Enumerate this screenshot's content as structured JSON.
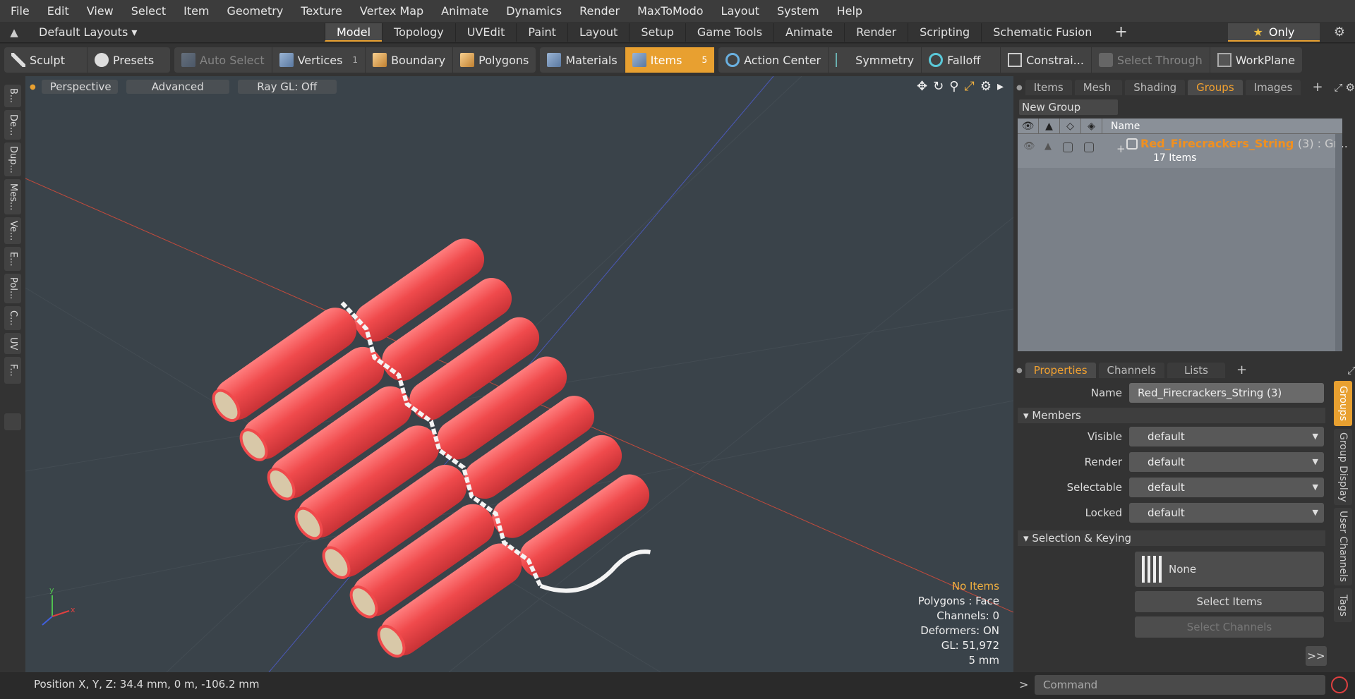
{
  "menu": [
    "File",
    "Edit",
    "View",
    "Select",
    "Item",
    "Geometry",
    "Texture",
    "Vertex Map",
    "Animate",
    "Dynamics",
    "Render",
    "MaxToModo",
    "Layout",
    "System",
    "Help"
  ],
  "layout": {
    "default_layouts": "Default Layouts ▾",
    "tabs": [
      "Model",
      "Topology",
      "UVEdit",
      "Paint",
      "Layout",
      "Setup",
      "Game Tools",
      "Animate",
      "Render",
      "Scripting",
      "Schematic Fusion"
    ],
    "active_tab": "Model",
    "only_label": "Only"
  },
  "toolbar": {
    "sculpt": "Sculpt",
    "presets": "Presets",
    "auto_select": "Auto Select",
    "vertices": "Vertices",
    "vertices_count": "1",
    "boundary": "Boundary",
    "polygons": "Polygons",
    "materials": "Materials",
    "items": "Items",
    "items_count": "5",
    "action_center": "Action Center",
    "symmetry": "Symmetry",
    "falloff": "Falloff",
    "constraints": "Constrai...",
    "select_through": "Select Through",
    "workplane": "WorkPlane"
  },
  "left_tabs": [
    "B...",
    "De...",
    "Dup...",
    "Mes...",
    "Ve...",
    "E...",
    "Pol...",
    "C...",
    "UV",
    "F..."
  ],
  "viewport": {
    "perspective": "Perspective",
    "advanced": "Advanced",
    "raygl": "Ray GL: Off",
    "info": {
      "no_items": "No Items",
      "polygons": "Polygons : Face",
      "channels": "Channels: 0",
      "deformers": "Deformers: ON",
      "gl": "GL: 51,972",
      "scale": "5 mm"
    }
  },
  "groups_panel": {
    "tabs": [
      "Items",
      "Mesh ...",
      "Shading",
      "Groups",
      "Images"
    ],
    "active_tab": "Groups",
    "new_group": "New Group",
    "name_header": "Name",
    "group_name": "Red_Firecrackers_String",
    "group_extra": "(3) : Gr...",
    "group_sub": "17 Items"
  },
  "properties": {
    "tabs": [
      "Properties",
      "Channels",
      "Lists"
    ],
    "active_tab": "Properties",
    "name_label": "Name",
    "name_value": "Red_Firecrackers_String (3)",
    "members": "Members",
    "visible_label": "Visible",
    "visible_value": "default",
    "render_label": "Render",
    "render_value": "default",
    "selectable_label": "Selectable",
    "selectable_value": "default",
    "locked_label": "Locked",
    "locked_value": "default",
    "selection_keying": "Selection & Keying",
    "none_label": "None",
    "select_items": "Select Items",
    "select_channels": "Select Channels",
    "more": ">>",
    "side_tabs": [
      "Groups",
      "Group Display",
      "User Channels",
      "Tags"
    ]
  },
  "status": {
    "position": "Position X, Y, Z:   34.4 mm, 0 m, -106.2 mm",
    "command_placeholder": "Command"
  },
  "colors": {
    "accent": "#e8a030",
    "firecracker": "#e8454a"
  }
}
